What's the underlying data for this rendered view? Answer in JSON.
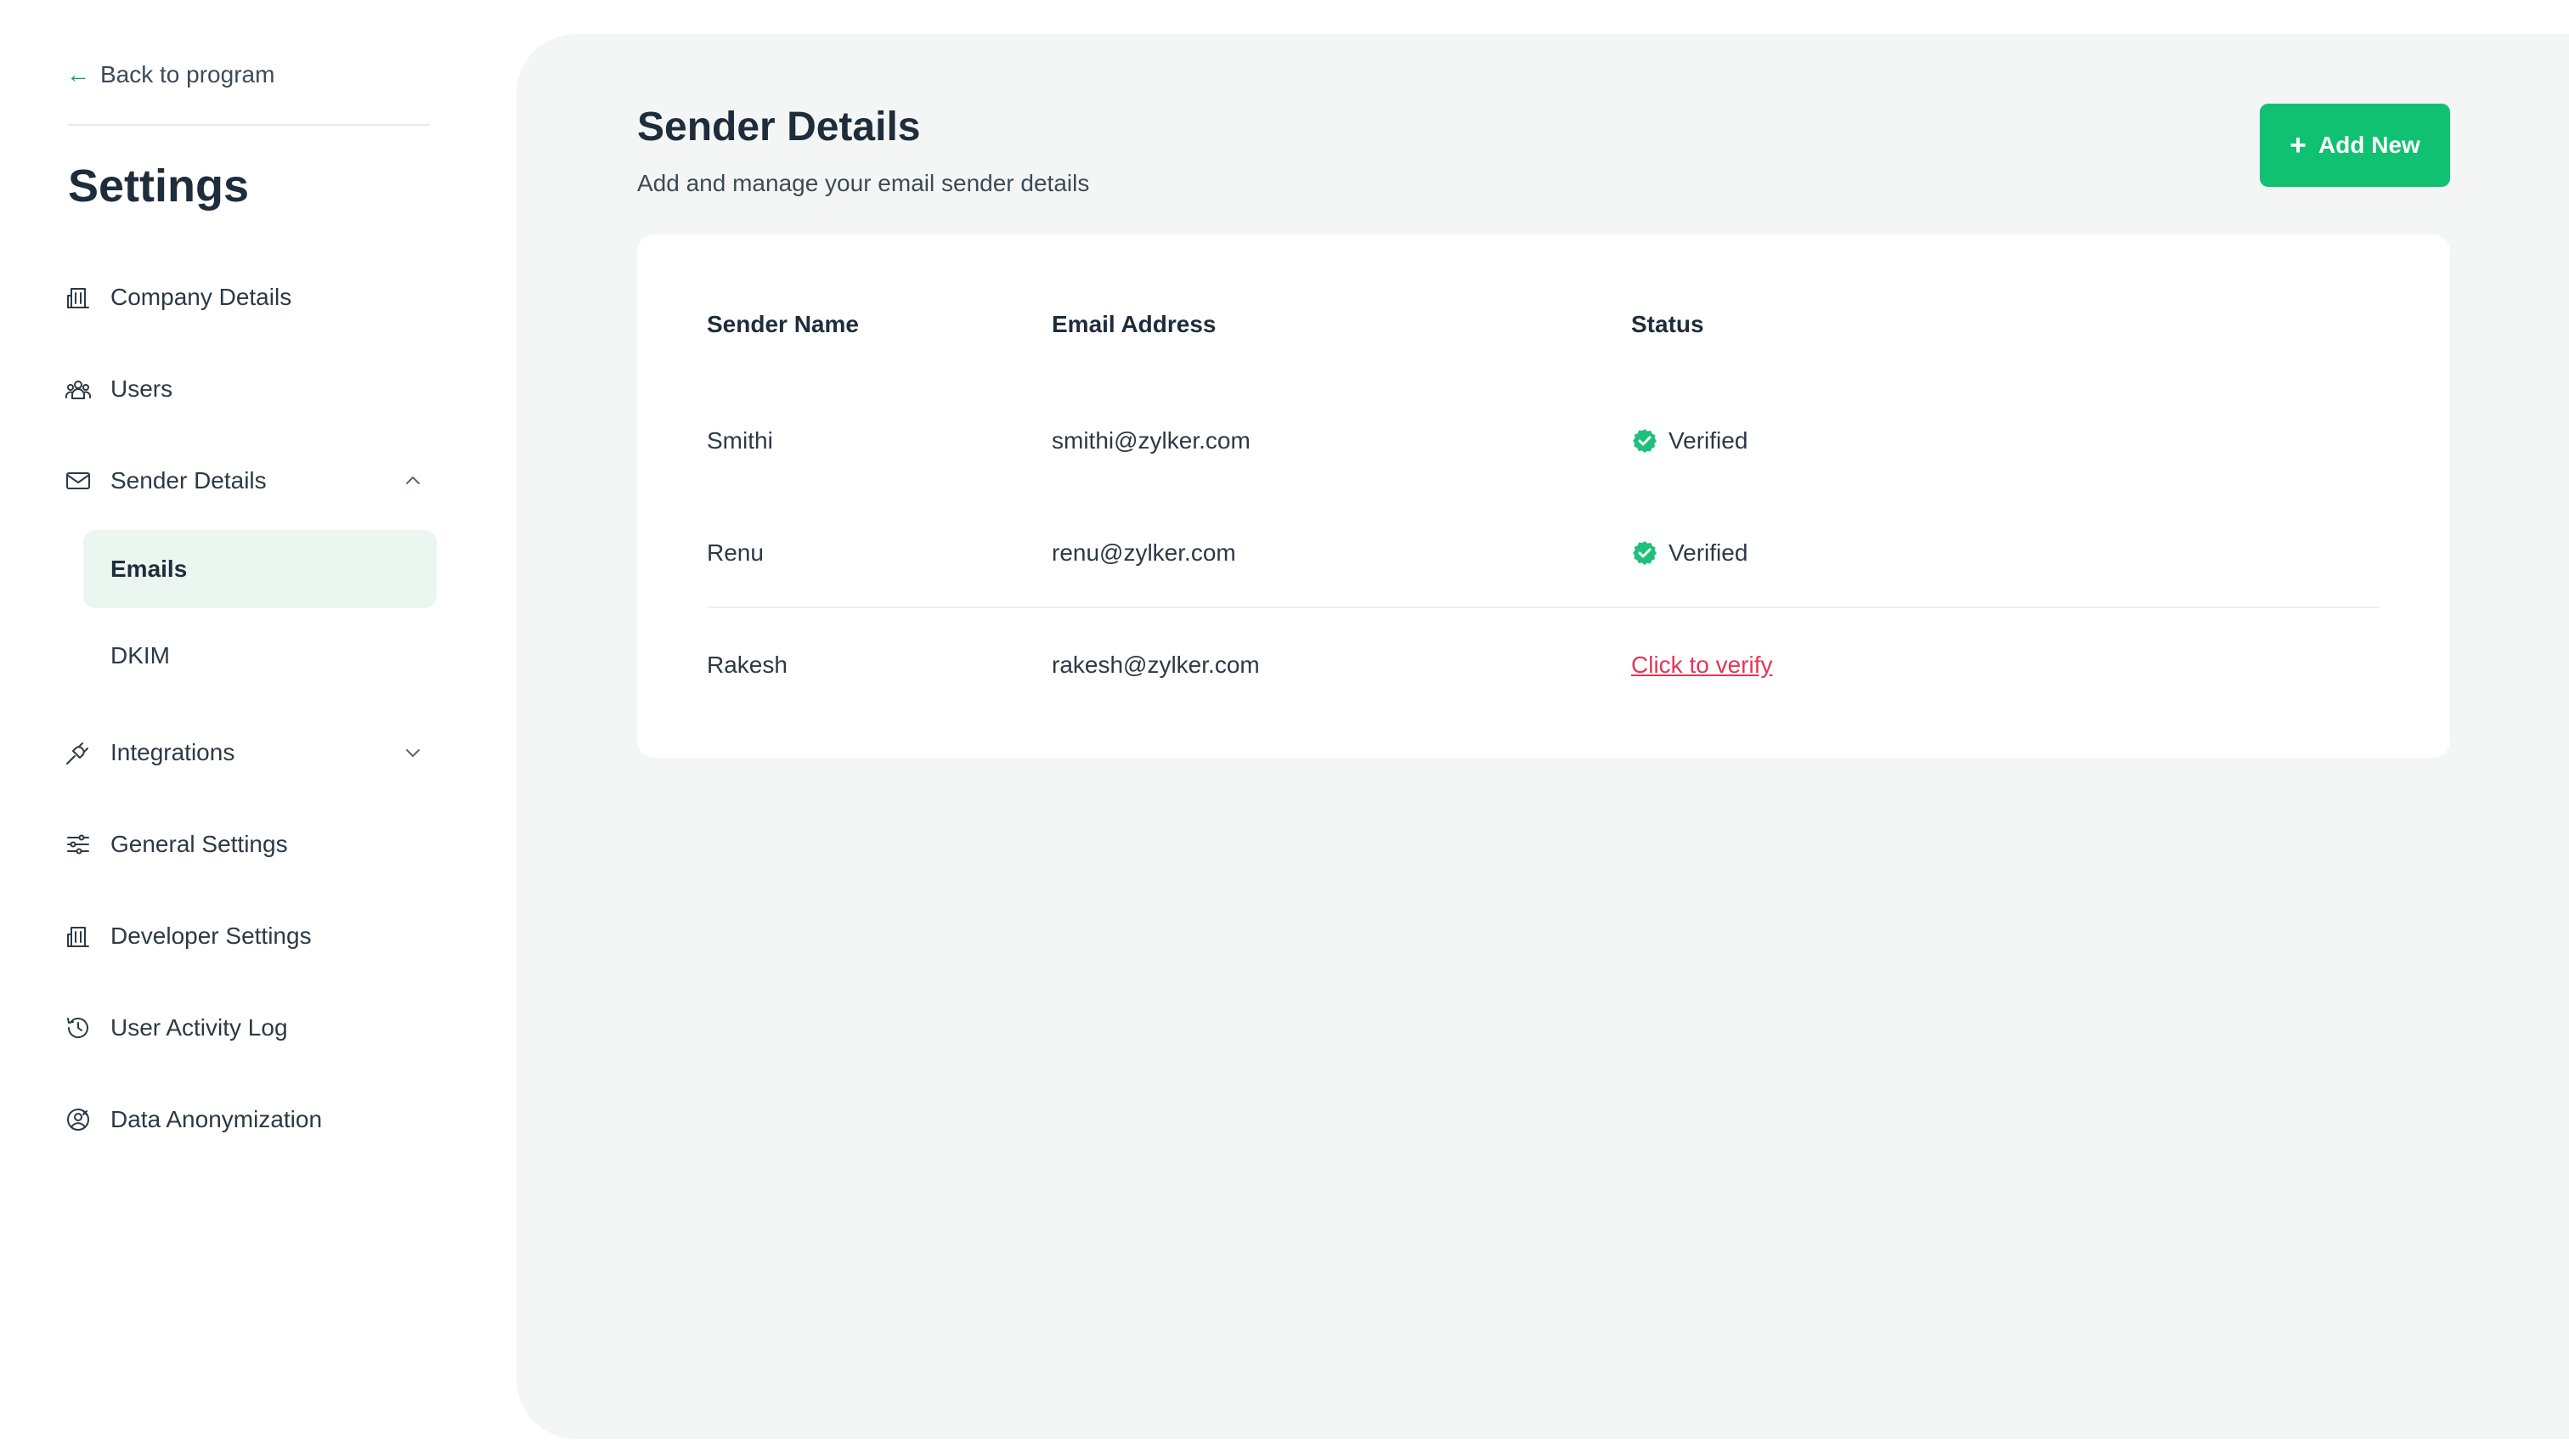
{
  "sidebar": {
    "back_label": "Back to program",
    "title": "Settings",
    "items": [
      {
        "label": "Company Details",
        "icon": "building-icon"
      },
      {
        "label": "Users",
        "icon": "users-icon"
      },
      {
        "label": "Sender Details",
        "icon": "envelope-icon",
        "expanded": true
      },
      {
        "label": "Integrations",
        "icon": "plug-icon",
        "expanded": false
      },
      {
        "label": "General Settings",
        "icon": "sliders-icon"
      },
      {
        "label": "Developer Settings",
        "icon": "building-icon"
      },
      {
        "label": "User Activity Log",
        "icon": "history-icon"
      },
      {
        "label": "Data Anonymization",
        "icon": "anonymous-user-icon"
      }
    ],
    "sender_subitems": [
      {
        "label": "Emails",
        "active": true
      },
      {
        "label": "DKIM",
        "active": false
      }
    ]
  },
  "main": {
    "title": "Sender Details",
    "subtitle": "Add and manage your email sender details",
    "add_button_label": "Add New",
    "table": {
      "headers": [
        "Sender Name",
        "Email Address",
        "Status"
      ],
      "rows": [
        {
          "name": "Smithi",
          "email": "smithi@zylker.com",
          "status": "Verified"
        },
        {
          "name": "Renu",
          "email": "renu@zylker.com",
          "status": "Verified"
        },
        {
          "name": "Rakesh",
          "email": "rakesh@zylker.com",
          "status": "Click to verify"
        }
      ]
    }
  },
  "colors": {
    "accent": "#10c172",
    "active_bg": "#ebf6f0",
    "main_bg": "#f4f6f5",
    "link_red": "#e03857",
    "verified_green": "#1ec07a"
  }
}
